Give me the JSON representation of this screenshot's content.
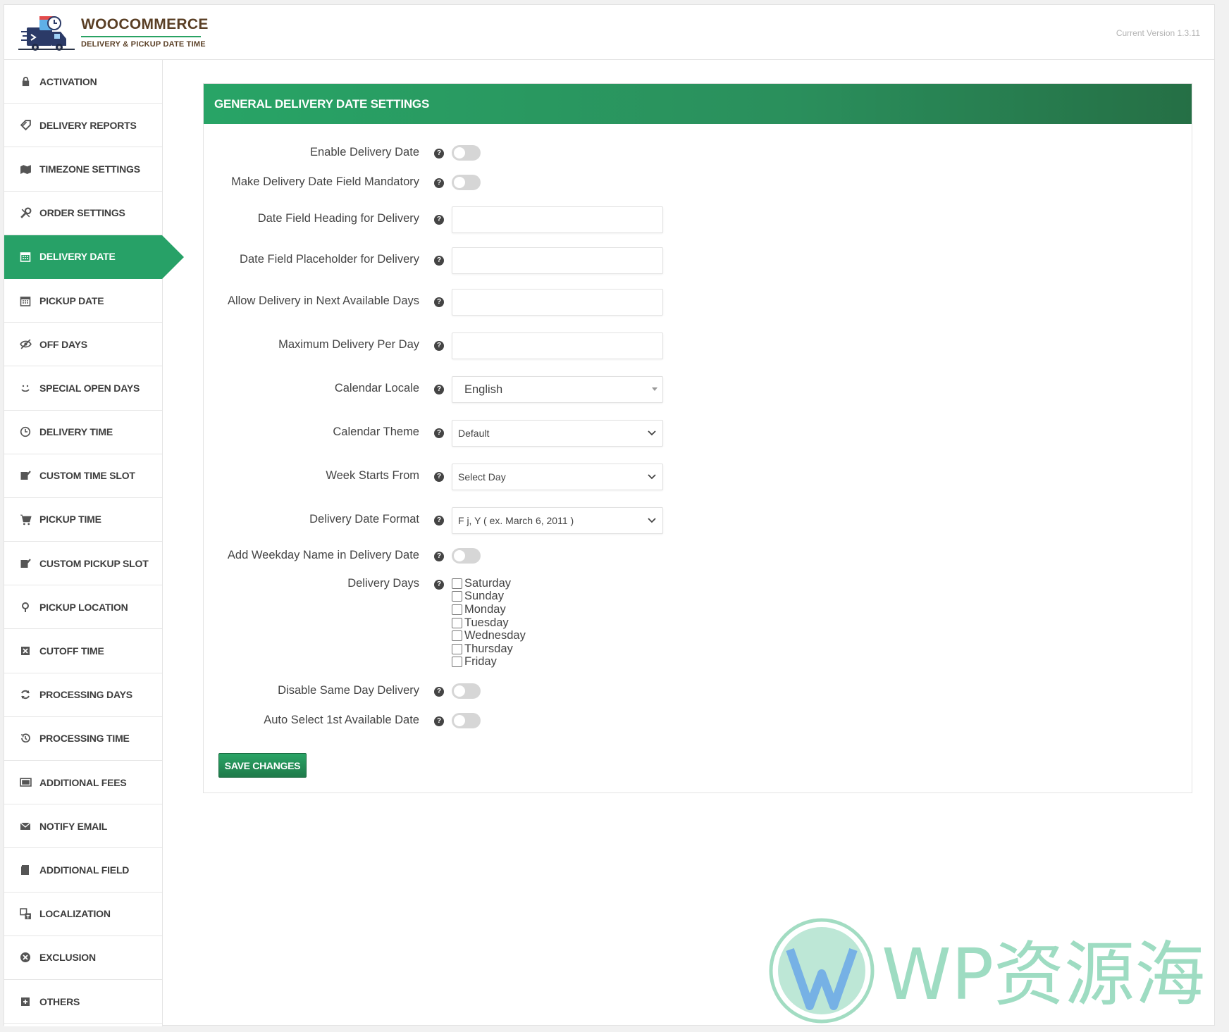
{
  "header": {
    "brand_title": "WOOCOMMERCE",
    "brand_subtitle": "DELIVERY & PICKUP DATE TIME",
    "version": "Current Version 1.3.11"
  },
  "sidebar": {
    "items": [
      {
        "label": "ACTIVATION",
        "icon": "lock-icon"
      },
      {
        "label": "DELIVERY REPORTS",
        "icon": "tag-icon"
      },
      {
        "label": "TIMEZONE SETTINGS",
        "icon": "map-icon"
      },
      {
        "label": "ORDER SETTINGS",
        "icon": "wrench-icon"
      },
      {
        "label": "DELIVERY DATE",
        "icon": "calendar-icon",
        "active": true
      },
      {
        "label": "PICKUP DATE",
        "icon": "calendar-icon"
      },
      {
        "label": "OFF DAYS",
        "icon": "eye-slash-icon"
      },
      {
        "label": "SPECIAL OPEN DAYS",
        "icon": "smile-icon"
      },
      {
        "label": "DELIVERY TIME",
        "icon": "clock-icon"
      },
      {
        "label": "CUSTOM TIME SLOT",
        "icon": "edit-icon"
      },
      {
        "label": "PICKUP TIME",
        "icon": "cart-icon"
      },
      {
        "label": "CUSTOM PICKUP SLOT",
        "icon": "edit-icon"
      },
      {
        "label": "PICKUP LOCATION",
        "icon": "map-pin-icon"
      },
      {
        "label": "CUTOFF TIME",
        "icon": "close-box-icon"
      },
      {
        "label": "PROCESSING DAYS",
        "icon": "refresh-icon"
      },
      {
        "label": "PROCESSING TIME",
        "icon": "history-icon"
      },
      {
        "label": "ADDITIONAL FEES",
        "icon": "money-icon"
      },
      {
        "label": "NOTIFY EMAIL",
        "icon": "envelope-icon"
      },
      {
        "label": "ADDITIONAL FIELD",
        "icon": "book-icon"
      },
      {
        "label": "LOCALIZATION",
        "icon": "translate-icon"
      },
      {
        "label": "EXCLUSION",
        "icon": "x-circle-icon"
      },
      {
        "label": "OTHERS",
        "icon": "plus-box-icon"
      }
    ]
  },
  "panel": {
    "title": "GENERAL DELIVERY DATE SETTINGS",
    "fields": {
      "enable_delivery_date": {
        "label": "Enable Delivery Date",
        "on": false
      },
      "mandatory": {
        "label": "Make Delivery Date Field Mandatory",
        "on": false
      },
      "heading": {
        "label": "Date Field Heading for Delivery",
        "value": ""
      },
      "placeholder": {
        "label": "Date Field Placeholder for Delivery",
        "value": ""
      },
      "next_days": {
        "label": "Allow Delivery in Next Available Days",
        "value": ""
      },
      "max_per_day": {
        "label": "Maximum Delivery Per Day",
        "value": ""
      },
      "locale": {
        "label": "Calendar Locale",
        "value": "English"
      },
      "theme": {
        "label": "Calendar Theme",
        "value": "Default"
      },
      "week_start": {
        "label": "Week Starts From",
        "value": "Select Day"
      },
      "date_format": {
        "label": "Delivery Date Format",
        "value": "F j, Y ( ex. March 6, 2011 )"
      },
      "weekday_name": {
        "label": "Add Weekday Name in Delivery Date",
        "on": false
      },
      "delivery_days": {
        "label": "Delivery Days",
        "options": [
          "Saturday",
          "Sunday",
          "Monday",
          "Tuesday",
          "Wednesday",
          "Thursday",
          "Friday"
        ]
      },
      "same_day": {
        "label": "Disable Same Day Delivery",
        "on": false
      },
      "auto_select": {
        "label": "Auto Select 1st Available Date",
        "on": false
      }
    },
    "save_label": "SAVE CHANGES",
    "help_glyph": "?"
  },
  "watermark": {
    "text": "WP资源海"
  },
  "colors": {
    "accent": "#27a167",
    "brand_brown": "#5a3f25"
  }
}
